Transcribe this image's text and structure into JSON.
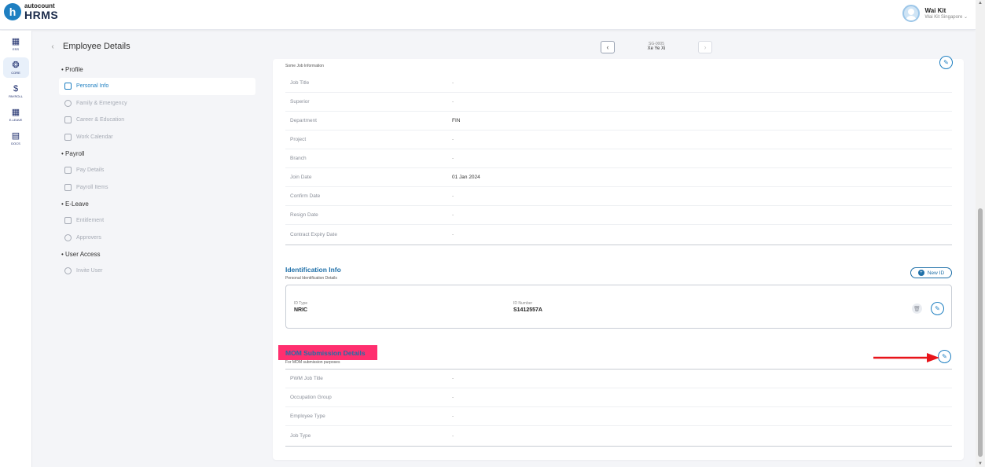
{
  "app": {
    "logo_small": "autocount",
    "logo_big": "HRMS",
    "logo_letter": "h"
  },
  "user": {
    "name": "Wai Kit",
    "company": "Wai Kit Singapore"
  },
  "rail": [
    {
      "label": "ESS",
      "icon": "ess-icon",
      "glyph": "▦",
      "active": false
    },
    {
      "label": "CORE",
      "icon": "core-icon",
      "glyph": "❂",
      "active": true
    },
    {
      "label": "PAYROLL",
      "icon": "dollar-icon",
      "glyph": "$",
      "active": false
    },
    {
      "label": "E-LEAVE",
      "icon": "calendar-icon",
      "glyph": "▦",
      "active": false
    },
    {
      "label": "DOCS",
      "icon": "docs-icon",
      "glyph": "▤",
      "active": false
    }
  ],
  "page": {
    "title": "Employee Details"
  },
  "employee": {
    "code": "SG-0005",
    "name": "Xe Ye Xi"
  },
  "subnav": {
    "profile": {
      "label": "Profile",
      "items": [
        "Personal Info",
        "Family & Emergency",
        "Career & Education",
        "Work Calendar"
      ]
    },
    "payroll": {
      "label": "Payroll",
      "items": [
        "Pay Details",
        "Payroll Items"
      ]
    },
    "eleave": {
      "label": "E-Leave",
      "items": [
        "Entitlement",
        "Approvers"
      ]
    },
    "access": {
      "label": "User Access",
      "items": [
        "Invite User"
      ]
    }
  },
  "job": {
    "subtitle": "Some Job Information",
    "fields": [
      {
        "label": "Job Title",
        "value": "-"
      },
      {
        "label": "Superior",
        "value": "-"
      },
      {
        "label": "Department",
        "value": "FIN"
      },
      {
        "label": "Project",
        "value": "-"
      },
      {
        "label": "Branch",
        "value": "-"
      },
      {
        "label": "Join Date",
        "value": "01 Jan 2024"
      },
      {
        "label": "Confirm Date",
        "value": "-"
      },
      {
        "label": "Resign Date",
        "value": "-"
      },
      {
        "label": "Contract Expiry Date",
        "value": "-"
      }
    ]
  },
  "identification": {
    "title": "Identification Info",
    "subtitle": "Personal Identification Details",
    "new_button": "New ID",
    "id_type_label": "ID Type",
    "id_type_value": "NRIC",
    "id_number_label": "ID Number",
    "id_number_value": "S1412557A"
  },
  "mom": {
    "title": "MOM Submission Details",
    "subtitle": "For MOM submission purposes",
    "fields": [
      {
        "label": "PWM Job Title",
        "value": "-"
      },
      {
        "label": "Occupation Group",
        "value": "-"
      },
      {
        "label": "Employee Type",
        "value": "-"
      },
      {
        "label": "Job Type",
        "value": "-"
      }
    ]
  },
  "colors": {
    "accent": "#1e7fc1",
    "highlight": "#ff2f6f",
    "arrow": "#e8141a"
  }
}
